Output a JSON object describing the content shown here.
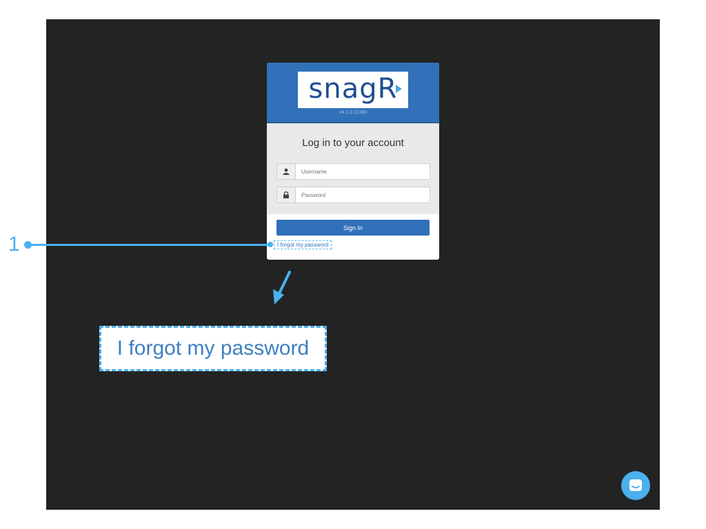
{
  "app": {
    "brand": "snagR",
    "version": "v4.1.0.11383"
  },
  "login": {
    "title": "Log in to your account",
    "username_placeholder": "Username",
    "password_placeholder": "Password",
    "signin_label": "Sign In",
    "forgot_label": "I forgot my password"
  },
  "callout": {
    "number": "1",
    "zoom_text": "I forgot my password",
    "color": "#4ab0ee"
  },
  "icons": {
    "username": "user-icon",
    "password": "lock-icon",
    "chat": "chat-icon"
  },
  "colors": {
    "header": "#3171b9",
    "button": "#3171b9",
    "link": "#3171b9",
    "background": "#232323",
    "annotation": "#4ab0ee"
  }
}
